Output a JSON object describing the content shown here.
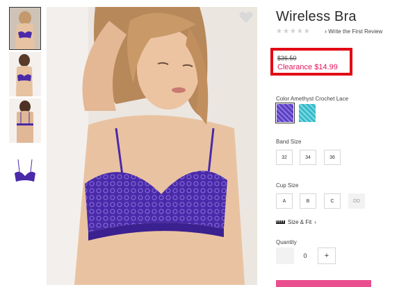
{
  "product": {
    "title": "Wireless Bra",
    "rating_stars": "★★★★★",
    "review_link": "Write the First Review",
    "review_arrow": "›",
    "original_price": "$36.50",
    "sale_price": "Clearance $14.99"
  },
  "color": {
    "label": "Color Amethyst Crochet Lace",
    "swatches": [
      {
        "name": "Amethyst Crochet Lace",
        "hex": "#5b3fc0",
        "selected": true
      },
      {
        "name": "Teal Lace",
        "hex": "#37b9c8",
        "selected": false
      }
    ]
  },
  "band_size": {
    "label": "Band Size",
    "options": [
      "32",
      "34",
      "36"
    ]
  },
  "cup_size": {
    "label": "Cup Size",
    "options": [
      {
        "label": "A",
        "available": true
      },
      {
        "label": "B",
        "available": true
      },
      {
        "label": "C",
        "available": true
      },
      {
        "label": "DD",
        "available": false
      }
    ]
  },
  "size_fit": {
    "label": "Size & Fit",
    "arrow": "›",
    "icon": "ruler-icon"
  },
  "quantity": {
    "label": "Quantity",
    "value": "0",
    "plus": "+"
  },
  "colors": {
    "highlight_box": "#e30613",
    "sale_text": "#e3125a",
    "product_purple": "#4a2aa8",
    "add_to_bag": "#ea4e8e"
  }
}
